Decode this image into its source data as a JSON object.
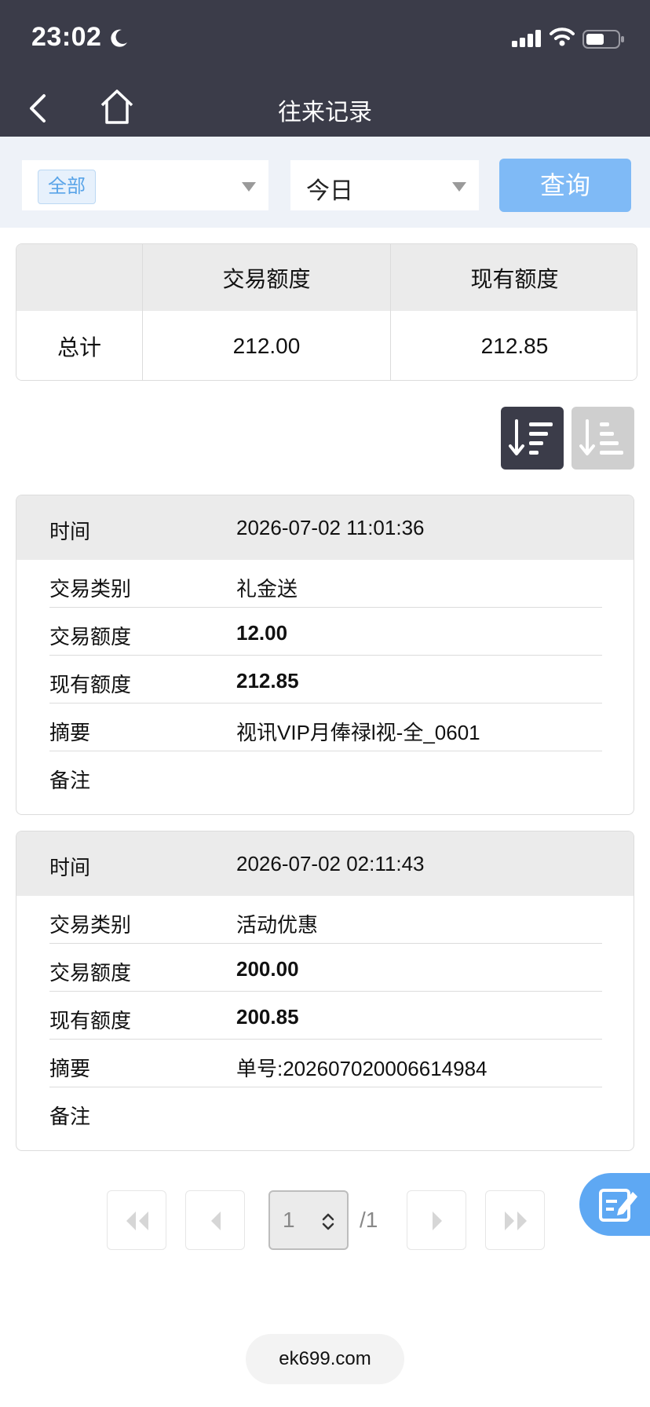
{
  "status_bar": {
    "time": "23:02"
  },
  "nav": {
    "title": "往来记录"
  },
  "filters": {
    "type_selected": "全部",
    "date_selected": "今日",
    "query_label": "查询"
  },
  "summary": {
    "headers": [
      "",
      "交易额度",
      "现有额度"
    ],
    "row": {
      "label": "总计",
      "trade_amount": "212.00",
      "balance": "212.85"
    }
  },
  "records": [
    {
      "time_label": "时间",
      "time": "2026-07-02 11:01:36",
      "type_label": "交易类别",
      "type": "礼金送",
      "amount_label": "交易额度",
      "amount": "12.00",
      "balance_label": "现有额度",
      "balance": "212.85",
      "summary_label": "摘要",
      "summary": "视讯VIP月俸禄l视-全_0601",
      "note_label": "备注",
      "note": ""
    },
    {
      "time_label": "时间",
      "time": "2026-07-02 02:11:43",
      "type_label": "交易类别",
      "type": "活动优惠",
      "amount_label": "交易额度",
      "amount": "200.00",
      "balance_label": "现有额度",
      "balance": "200.85",
      "summary_label": "摘要",
      "summary": "单号:202607020006614984",
      "note_label": "备注",
      "note": ""
    }
  ],
  "pagination": {
    "current_page": "1",
    "total": "/1"
  },
  "footer": {
    "domain": "ek699.com"
  },
  "colors": {
    "header_bg": "#3b3c49",
    "accent": "#7fbaf6",
    "fab": "#5ea8f3"
  }
}
